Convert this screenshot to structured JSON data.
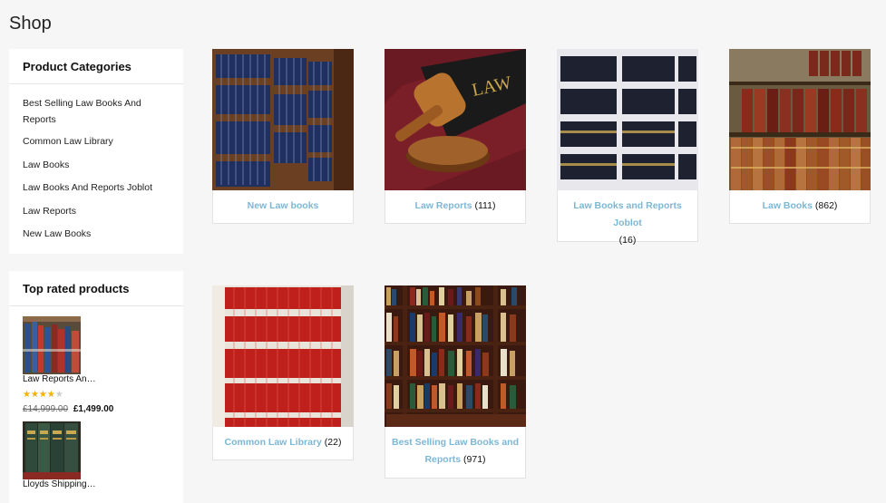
{
  "page": {
    "title": "Shop"
  },
  "categories_widget": {
    "title": "Product Categories",
    "items": [
      "Best Selling Law Books And Reports",
      "Common Law Library",
      "Law Books",
      "Law Books And Reports Joblot",
      "Law Reports",
      "New Law Books"
    ]
  },
  "top_rated_widget": {
    "title": "Top rated products",
    "products": [
      {
        "name": "Law Reports An…",
        "rating": 4,
        "rating_max": 5,
        "old_price": "£14,999.00",
        "new_price": "£1,499.00"
      },
      {
        "name": "Lloyds Shipping…"
      }
    ]
  },
  "category_cards": [
    {
      "name": "New Law books",
      "count": ""
    },
    {
      "name": "Law Reports",
      "count": "(111)"
    },
    {
      "name": "Law Books and Reports Joblot",
      "count": "(16)"
    },
    {
      "name": "Law Books",
      "count": "(862)"
    },
    {
      "name": "Common Law Library",
      "count": "(22)"
    },
    {
      "name": "Best Selling Law Books and Reports",
      "count": "(971)"
    }
  ],
  "colors": {
    "link": "#7cb7d6",
    "star": "#f5b301",
    "background": "#f6f6f6"
  }
}
